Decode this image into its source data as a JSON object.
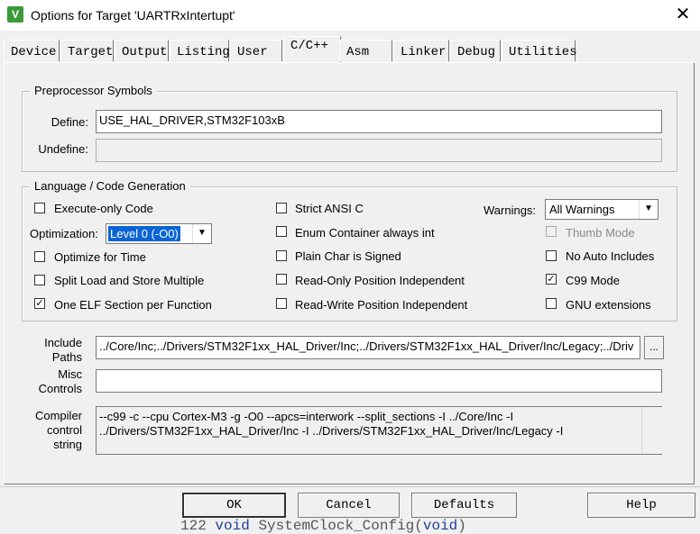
{
  "window": {
    "title": "Options for Target 'UARTRxIntertupt'",
    "icon": "keil-icon",
    "close": "✕"
  },
  "tabs": [
    "Device",
    "Target",
    "Output",
    "Listing",
    "User",
    "C/C++",
    "Asm",
    "Linker",
    "Debug",
    "Utilities"
  ],
  "preprocessor": {
    "title": "Preprocessor Symbols",
    "define_label": "Define:",
    "define_value": "USE_HAL_DRIVER,STM32F103xB",
    "undefine_label": "Undefine:",
    "undefine_value": ""
  },
  "codegen": {
    "title": "Language / Code Generation",
    "execute_only": {
      "label": "Execute-only Code",
      "checked": false
    },
    "optimization_label": "Optimization:",
    "optimization_value": "Level 0 (-O0)",
    "optimize_time": {
      "label": "Optimize for Time",
      "checked": false
    },
    "split_load": {
      "label": "Split Load and Store Multiple",
      "checked": false
    },
    "one_elf": {
      "label": "One ELF Section per Function",
      "checked": true
    },
    "strict_ansi": {
      "label": "Strict ANSI C",
      "checked": false
    },
    "enum_container": {
      "label": "Enum Container always int",
      "checked": false
    },
    "plain_char": {
      "label": "Plain Char is Signed",
      "checked": false
    },
    "ro_position": {
      "label": "Read-Only Position Independent",
      "checked": false
    },
    "rw_position": {
      "label": "Read-Write Position Independent",
      "checked": false
    },
    "warnings_label": "Warnings:",
    "warnings_value": "All Warnings",
    "thumb_mode": {
      "label": "Thumb Mode",
      "checked": false,
      "disabled": true
    },
    "no_auto_includes": {
      "label": "No Auto Includes",
      "checked": false
    },
    "c99_mode": {
      "label": "C99 Mode",
      "checked": true
    },
    "gnu_extensions": {
      "label": "GNU extensions",
      "checked": false
    }
  },
  "include": {
    "label_line1": "Include",
    "label_line2": "Paths",
    "value": "../Core/Inc;../Drivers/STM32F1xx_HAL_Driver/Inc;../Drivers/STM32F1xx_HAL_Driver/Inc/Legacy;../Driv",
    "browse": "..."
  },
  "misc": {
    "label_line1": "Misc",
    "label_line2": "Controls",
    "value": ""
  },
  "compiler": {
    "label_line1": "Compiler",
    "label_line2": "control",
    "label_line3": "string",
    "line1": "--c99 -c --cpu Cortex-M3 -g -O0 --apcs=interwork --split_sections -I ../Core/Inc -I",
    "line2": "../Drivers/STM32F1xx_HAL_Driver/Inc -I ../Drivers/STM32F1xx_HAL_Driver/Inc/Legacy -I"
  },
  "buttons": {
    "ok": "OK",
    "cancel": "Cancel",
    "defaults": "Defaults",
    "help": "Help"
  },
  "background_code": {
    "line_no": "122",
    "kw1": "void",
    "fn": "SystemClock_Config(",
    "kw2": "void",
    "end": ")"
  },
  "colors": {
    "selection": "#0a64d4",
    "icon": "#3a9a3a"
  }
}
